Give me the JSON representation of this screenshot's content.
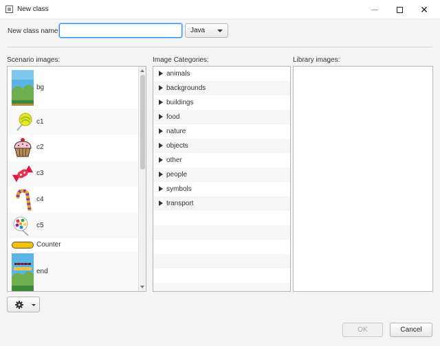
{
  "window": {
    "title": "New class",
    "controls": [
      "minimize",
      "maximize",
      "close"
    ]
  },
  "form": {
    "name_label": "New class name:",
    "name_value": "",
    "language": "Java"
  },
  "columns": {
    "scenario_label": "Scenario images:",
    "categories_label": "Image Categories:",
    "library_label": "Library images:"
  },
  "scenario_images": [
    {
      "name": "bg",
      "icon": "bg-image-icon"
    },
    {
      "name": "c1",
      "icon": "lollipop-icon"
    },
    {
      "name": "c2",
      "icon": "cupcake-icon"
    },
    {
      "name": "c3",
      "icon": "candy-icon"
    },
    {
      "name": "c4",
      "icon": "candy-cane-icon"
    },
    {
      "name": "c5",
      "icon": "swirl-lollipop-icon"
    },
    {
      "name": "Counter",
      "icon": "counter-bar-icon"
    },
    {
      "name": "end",
      "icon": "end-image-icon"
    }
  ],
  "categories": [
    "animals",
    "backgrounds",
    "buildings",
    "food",
    "nature",
    "objects",
    "other",
    "people",
    "symbols",
    "transport"
  ],
  "footer": {
    "ok_label": "OK",
    "ok_enabled": false,
    "cancel_label": "Cancel",
    "settings_icon": "gear-icon"
  },
  "colors": {
    "focus_border": "#1e90ff",
    "panel_border": "#b5b5b5"
  }
}
